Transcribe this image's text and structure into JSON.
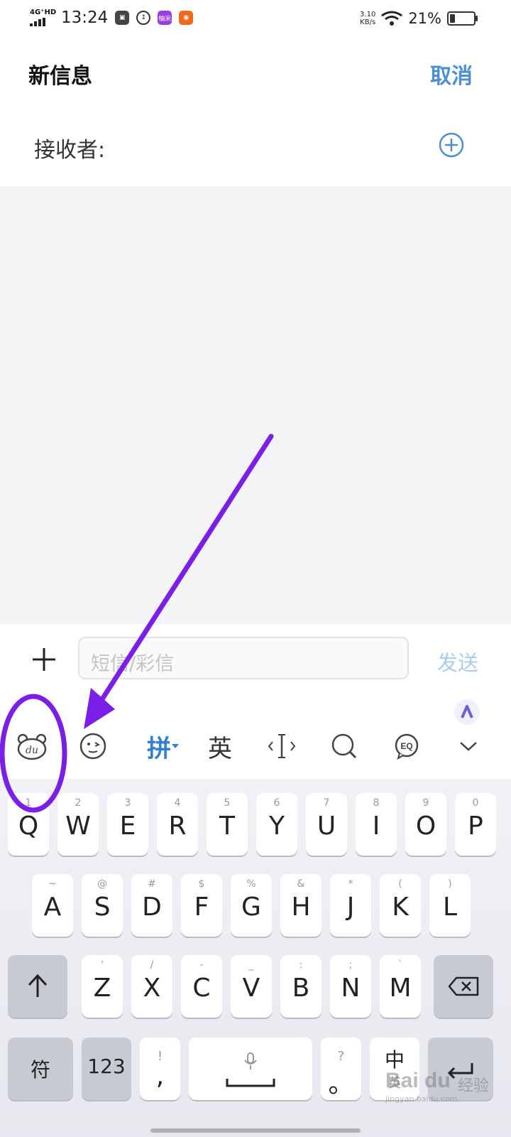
{
  "status_bar": {
    "network": "4G⁺HD",
    "time": "13:24",
    "app_badge": "柚米",
    "speed_value": "3.10",
    "speed_unit": "KB/s",
    "battery_percent": "21%",
    "battery_level": 0.21
  },
  "header": {
    "title": "新信息",
    "cancel_label": "取消"
  },
  "recipient": {
    "label": "接收者:",
    "add_icon": "plus-circle-icon"
  },
  "compose": {
    "attach_icon": "plus-icon",
    "placeholder": "短信/彩信",
    "send_label": "发送"
  },
  "keyboard_toolbar": {
    "logo_icon": "du-bear-icon",
    "emoji_icon": "emoji-face-icon",
    "pinyin_label": "拼",
    "english_label": "英",
    "cursor_icon": "cursor-move-icon",
    "search_icon": "search-icon",
    "eq_icon": "eq-bubble-icon",
    "collapse_icon": "chevron-down-icon",
    "assist_icon": "assistant-icon"
  },
  "keyboard": {
    "row1": [
      {
        "main": "Q",
        "sub": "1"
      },
      {
        "main": "W",
        "sub": "2"
      },
      {
        "main": "E",
        "sub": "3"
      },
      {
        "main": "R",
        "sub": "4"
      },
      {
        "main": "T",
        "sub": "5"
      },
      {
        "main": "Y",
        "sub": "6"
      },
      {
        "main": "U",
        "sub": "7"
      },
      {
        "main": "I",
        "sub": "8"
      },
      {
        "main": "O",
        "sub": "9"
      },
      {
        "main": "P",
        "sub": "0"
      }
    ],
    "row2": [
      {
        "main": "A",
        "sub": "~"
      },
      {
        "main": "S",
        "sub": "@"
      },
      {
        "main": "D",
        "sub": "#"
      },
      {
        "main": "F",
        "sub": "$"
      },
      {
        "main": "G",
        "sub": "%"
      },
      {
        "main": "H",
        "sub": "&"
      },
      {
        "main": "J",
        "sub": "*"
      },
      {
        "main": "K",
        "sub": "("
      },
      {
        "main": "L",
        "sub": ")"
      }
    ],
    "row3": [
      {
        "main": "Z",
        "sub": "'"
      },
      {
        "main": "X",
        "sub": "/"
      },
      {
        "main": "C",
        "sub": "-"
      },
      {
        "main": "V",
        "sub": "_"
      },
      {
        "main": "B",
        "sub": ":"
      },
      {
        "main": "N",
        "sub": ";"
      },
      {
        "main": "M",
        "sub": "`"
      }
    ],
    "symbols_label": "符",
    "numbers_label": "123",
    "comma_main": ",",
    "comma_sub": "!",
    "period_main": "。",
    "period_sub": "?",
    "zh_label": "中",
    "zh_sub": "英",
    "shift_icon": "shift-arrow-icon",
    "backspace_icon": "backspace-icon",
    "mic_icon": "microphone-icon",
    "enter_icon": "enter-icon"
  },
  "watermark": {
    "logo": "Bai du",
    "text": "经验",
    "url": "jingyan.baidu.com"
  },
  "annotation": {
    "color": "#7b1fe8"
  }
}
